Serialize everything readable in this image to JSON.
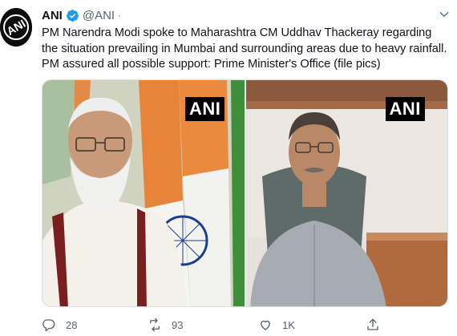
{
  "tweet": {
    "author_name": "ANI",
    "author_handle": "@ANI",
    "separator": "·",
    "text": "PM Narendra Modi spoke to Maharashtra CM Uddhav Thackeray regarding the situation prevailing in Mumbai and surrounding areas due to heavy rainfall. PM assured all possible support: Prime Minister's Office (file pics)",
    "avatar_label": "ANI",
    "verified_icon": "verified-badge-icon",
    "menu_icon": "chevron-down-icon",
    "photos": [
      {
        "watermark": "ANI"
      },
      {
        "watermark": "ANI"
      }
    ],
    "actions": {
      "reply_count": "28",
      "retweet_count": "93",
      "like_count": "1K"
    }
  },
  "colors": {
    "text": "#0f1419",
    "secondary": "#536471",
    "verified": "#1d9bf0",
    "watermark_bg": "#000000"
  }
}
